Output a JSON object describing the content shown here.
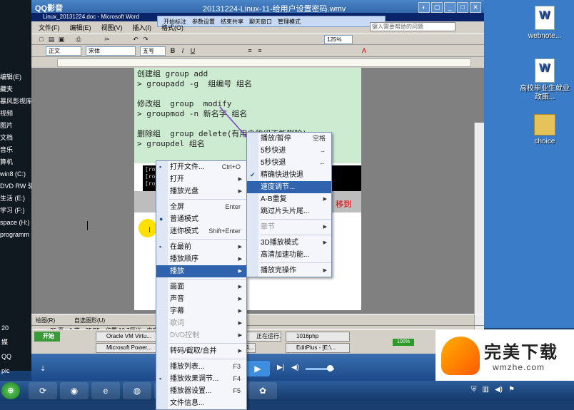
{
  "player": {
    "app_name": "QQ影音",
    "window_title": "20131224-Linux-11-给用户设置密码.wmv"
  },
  "word": {
    "title": "Linux_20131224.doc - Microsoft Word",
    "qq_banner": [
      "开始标注",
      "参数设置",
      "结束共享",
      "聊天窗口",
      "管理模式"
    ],
    "menus": [
      "文件(F)",
      "编辑(E)",
      "视图(V)",
      "插入(I)",
      "格式(O)"
    ],
    "help_placeholder": "键入需要帮助的问题",
    "style_box": "正文",
    "font_box": "宋体",
    "size_box": "五号",
    "zoom": "125%",
    "lines": [
      "创建组 group add",
      "> groupadd -g  组编号 组名",
      "",
      "修改组  group  modify",
      "> groupmod -n 新名字 组名",
      "",
      "删除组  group delete(有用户的组不能删除)",
      "> groupdel 组名"
    ],
    "terminal_lines": [
      "[root@localhost ~]#",
      "[root@localhost ~]#",
      "[root@localhost ~]#"
    ],
    "move_text": "移到",
    "drawbar_label": "绘图(R)",
    "autoshape_label": "自选图形(U)",
    "status": [
      "25 页",
      "1 节",
      "25/25",
      "位置 10.7厘米",
      "中文(中国)"
    ]
  },
  "context_menu": {
    "items": [
      {
        "label": "打开文件...",
        "shortcut": "Ctrl+O",
        "icon": "open-file-icon"
      },
      {
        "label": "打开",
        "submenu": true
      },
      {
        "label": "播放光盘",
        "submenu": true
      },
      {
        "sep": true
      },
      {
        "label": "全屏",
        "shortcut": "Enter"
      },
      {
        "label": "普通模式",
        "bullet": true
      },
      {
        "label": "迷你模式",
        "shortcut": "Shift+Enter"
      },
      {
        "sep": true
      },
      {
        "label": "在最前",
        "submenu": true,
        "icon": "pin-icon"
      },
      {
        "label": "播放顺序",
        "submenu": true
      },
      {
        "label": "播放",
        "submenu": true,
        "highlight": true
      },
      {
        "sep": true
      },
      {
        "label": "画面",
        "submenu": true
      },
      {
        "label": "声音",
        "submenu": true
      },
      {
        "label": "字幕",
        "submenu": true
      },
      {
        "label": "歌词",
        "submenu": true,
        "disabled": true
      },
      {
        "label": "DVD控制",
        "submenu": true,
        "disabled": true
      },
      {
        "sep": true
      },
      {
        "label": "转码/截取/合并",
        "submenu": true
      },
      {
        "sep": true
      },
      {
        "label": "播放列表...",
        "shortcut": "F3"
      },
      {
        "label": "播放效果调节...",
        "shortcut": "F4",
        "icon": "effect-icon"
      },
      {
        "label": "播放器设置...",
        "shortcut": "F5"
      },
      {
        "label": "文件信息..."
      }
    ]
  },
  "play_submenu": {
    "items": [
      {
        "label": "播放/暂停",
        "shortcut": "空格"
      },
      {
        "label": "5秒快进",
        "shortcut": "→"
      },
      {
        "label": "5秒快退",
        "shortcut": "←"
      },
      {
        "label": "精确快进快退",
        "check": true
      },
      {
        "label": "速度调节...",
        "highlight": true
      },
      {
        "label": "A-B重复",
        "submenu": true
      },
      {
        "label": "跳过片头片尾..."
      },
      {
        "sep": true
      },
      {
        "label": "章节",
        "submenu": true,
        "disabled": true
      },
      {
        "sep": true
      },
      {
        "label": "3D播放模式",
        "submenu": true
      },
      {
        "label": "高清加速功能..."
      },
      {
        "sep": true
      },
      {
        "label": "播放完操作",
        "submenu": true
      }
    ]
  },
  "desktop_icons": [
    {
      "label": "webnote...",
      "type": "doc"
    },
    {
      "label": "高校毕业生就业政策...",
      "type": "doc"
    },
    {
      "label": "choice",
      "type": "folder"
    }
  ],
  "left_labels": [
    "编辑(E)",
    "藏夹",
    "暴风影视库",
    "视频",
    "图片",
    "文档",
    "音乐",
    "算机",
    "win8 (C:)",
    "DVD RW 驱",
    "生活 (E:)",
    "学习 (F:)",
    "space (H:)",
    "programm"
  ],
  "inner_taskbar": {
    "start": "开始",
    "tasks": [
      "Oracle VM Virtu...",
      "Microsoft Power...",
      "20131224...",
      "正在运行...",
      "1016php",
      "EditPlus - [E:\\..."
    ],
    "percent": "100%"
  },
  "host_taskbar": {
    "apps": [
      "360",
      "QQ",
      "IE",
      "Firefox",
      "Explorer",
      "Word",
      "Player",
      "Media"
    ]
  },
  "watermark": {
    "title": "完美下载",
    "url": "wmzhe.com"
  },
  "left_strip": [
    "20",
    "媒",
    "QQ",
    "pic"
  ]
}
